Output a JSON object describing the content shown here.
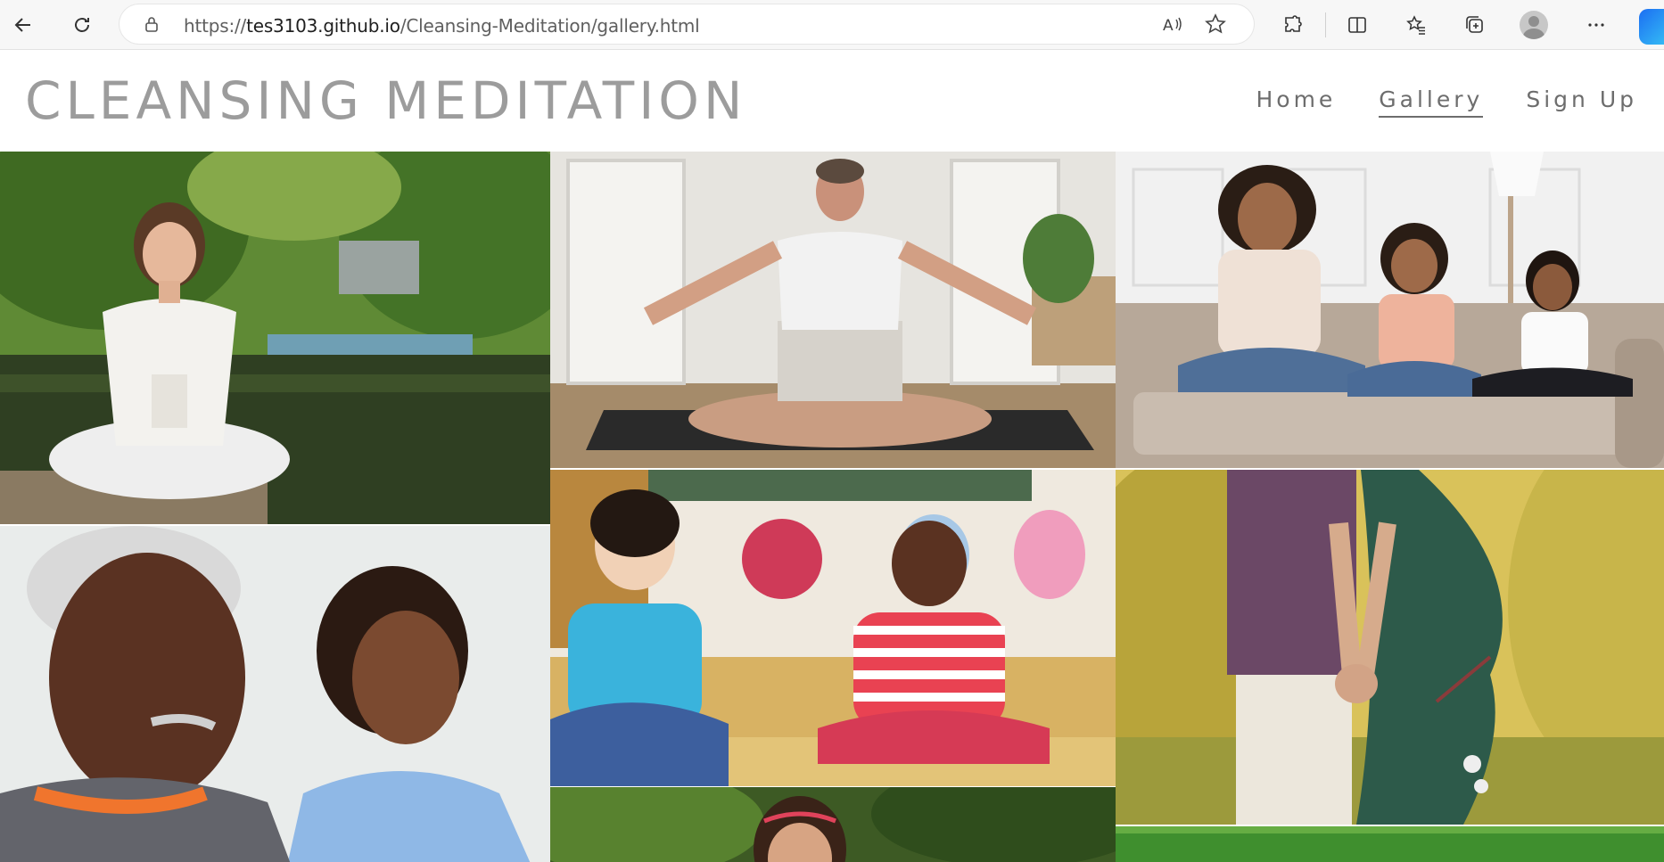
{
  "browser": {
    "url_prefix": "https://",
    "url_host": "tes3103.github.io",
    "url_path": "/Cleansing-Meditation/gallery.html"
  },
  "site": {
    "logo": "CLEANSING MEDITATION",
    "nav": [
      {
        "label": "Home"
      },
      {
        "label": "Gallery"
      },
      {
        "label": "Sign Up"
      }
    ]
  },
  "gallery": {
    "images": [
      {
        "subject": "woman meditating by a lake"
      },
      {
        "subject": "man meditating on a yoga mat"
      },
      {
        "subject": "mother and children meditating on a sofa"
      },
      {
        "subject": "older man and woman with eyes closed"
      },
      {
        "subject": "children meditating in a classroom"
      },
      {
        "subject": "couple holding hands, pregnant woman"
      },
      {
        "subject": "girl meditating outdoors"
      },
      {
        "subject": "grass field"
      }
    ]
  },
  "colors": {
    "logo": "#9c9c9c",
    "nav": "#6d6d6d"
  }
}
